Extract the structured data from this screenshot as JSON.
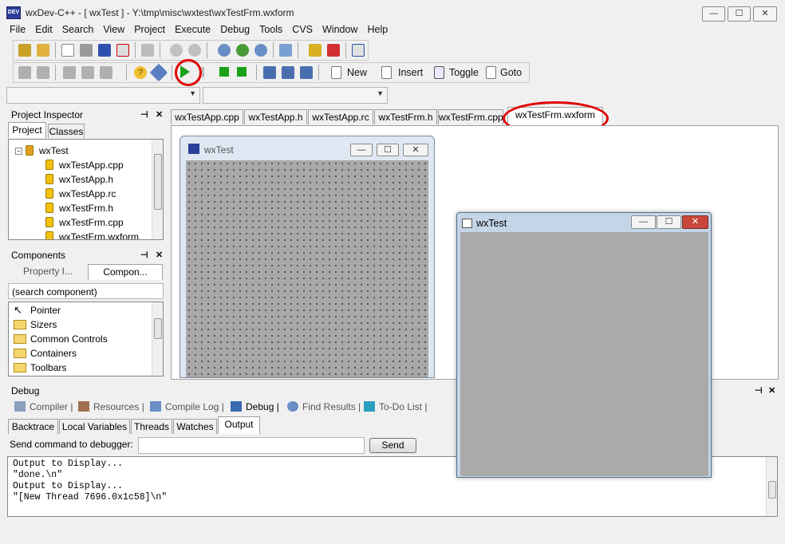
{
  "window": {
    "title": "wxDev-C++ - [ wxTest ] - Y:\\tmp\\misc\\wxtest\\wxTestFrm.wxform",
    "icon_text": "DEV",
    "min": "—",
    "max": "☐",
    "close": "✕"
  },
  "menu": [
    "File",
    "Edit",
    "Search",
    "View",
    "Project",
    "Execute",
    "Debug",
    "Tools",
    "CVS",
    "Window",
    "Help"
  ],
  "toolbar2": {
    "new": "New",
    "insert": "Insert",
    "toggle": "Toggle",
    "goto": "Goto"
  },
  "project_inspector": {
    "title": "Project Inspector",
    "tabs": [
      "Project",
      "Classes"
    ],
    "root": "wxTest",
    "files": [
      "wxTestApp.cpp",
      "wxTestApp.h",
      "wxTestApp.rc",
      "wxTestFrm.h",
      "wxTestFrm.cpp",
      "wxTestFrm.wxform"
    ]
  },
  "components": {
    "title": "Components",
    "tabs": [
      "Property I...",
      "Compon..."
    ],
    "search_placeholder": "(search component)",
    "items": [
      "Pointer",
      "Sizers",
      "Common Controls",
      "Containers",
      "Toolbars"
    ]
  },
  "editor_tabs": [
    "wxTestApp.cpp",
    "wxTestApp.h",
    "wxTestApp.rc",
    "wxTestFrm.h",
    "wxTestFrm.cpp",
    "wxTestFrm.wxform"
  ],
  "designer_form": {
    "title": "wxTest"
  },
  "running_window": {
    "title": "wxTest"
  },
  "debug": {
    "title": "Debug",
    "bottom_tabs": [
      "Compiler",
      "Resources",
      "Compile Log",
      "Debug",
      "Find Results",
      "To-Do List"
    ],
    "sub_tabs": [
      "Backtrace",
      "Local Variables",
      "Threads",
      "Watches",
      "Output"
    ],
    "send_label": "Send command to debugger:",
    "send_button": "Send",
    "output": "Output to Display...\n\"done.\\n\"\nOutput to Display...\n\"[New Thread 7696.0x1c58]\\n\""
  },
  "colors": {
    "highlight_ring": "#e00000",
    "run_green": "#1aa11a"
  }
}
